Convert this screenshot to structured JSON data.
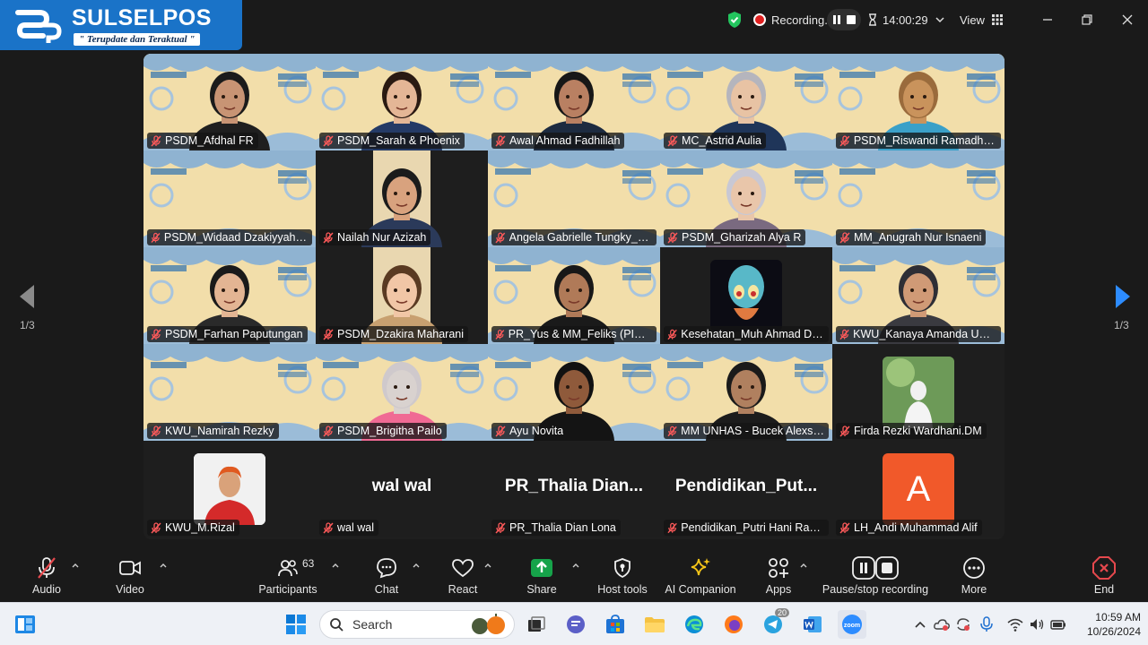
{
  "logo": {
    "name": "SULSELPOS",
    "tagline": "\" Terupdate dan Teraktual \""
  },
  "topbar": {
    "recording_label": "Recording...",
    "timer": "14:00:29",
    "view_label": "View"
  },
  "pager": {
    "left": "1/3",
    "right": "1/3"
  },
  "tiles": [
    "PSDM_Afdhal FR",
    "PSDM_Sarah & Phoenix",
    "Awal Ahmad Fadhillah",
    "MC_Astrid Aulia",
    "PSDM_Riswandi Ramadhani",
    "PSDM_Widaad Dzakiyyah Se...",
    "Nailah Nur Azizah",
    "Angela Gabrielle Tungky_MM",
    "PSDM_Gharizah Alya R",
    "MM_Anugrah Nur Isnaeni",
    "PSDM_Farhan Paputungan",
    "PSDM_Dzakira Maharani",
    "PR_Yus & MM_Feliks (PIC PS...",
    "Kesehatan_Muh Ahmad Dha...",
    "KWU_Kanaya Amanda Umm...",
    "KWU_Namirah Rezky",
    "PSDM_Brigitha Pailo",
    "Ayu Novita",
    "MM UNHAS - Bucek Alexsan...",
    "Firda Rezki Wardhani.DM",
    "KWU_M.Rizal",
    "wal wal",
    "PR_Thalia Dian Lona",
    "Pendidikan_Putri Hani Rania...",
    "LH_Andi Muhammad Alif"
  ],
  "big_names": {
    "wal": "wal wal",
    "thalia": "PR_Thalia  Dian...",
    "pendidikan": "Pendidikan_Put..."
  },
  "avatar_letter": "A",
  "toolbar": {
    "audio": "Audio",
    "video": "Video",
    "participants": "Participants",
    "participants_count": "63",
    "chat": "Chat",
    "react": "React",
    "share": "Share",
    "host_tools": "Host tools",
    "ai_companion": "AI Companion",
    "apps": "Apps",
    "pause_stop": "Pause/stop recording",
    "more": "More",
    "end": "End"
  },
  "taskbar": {
    "search_placeholder": "Search",
    "telegram_badge": "20",
    "time": "10:59 AM",
    "date": "10/26/2024"
  },
  "colors": {
    "active_speaker": "#23d18b",
    "end_red": "#e5484d",
    "share_green": "#16a34a",
    "logo_blue": "#1a73c8"
  }
}
